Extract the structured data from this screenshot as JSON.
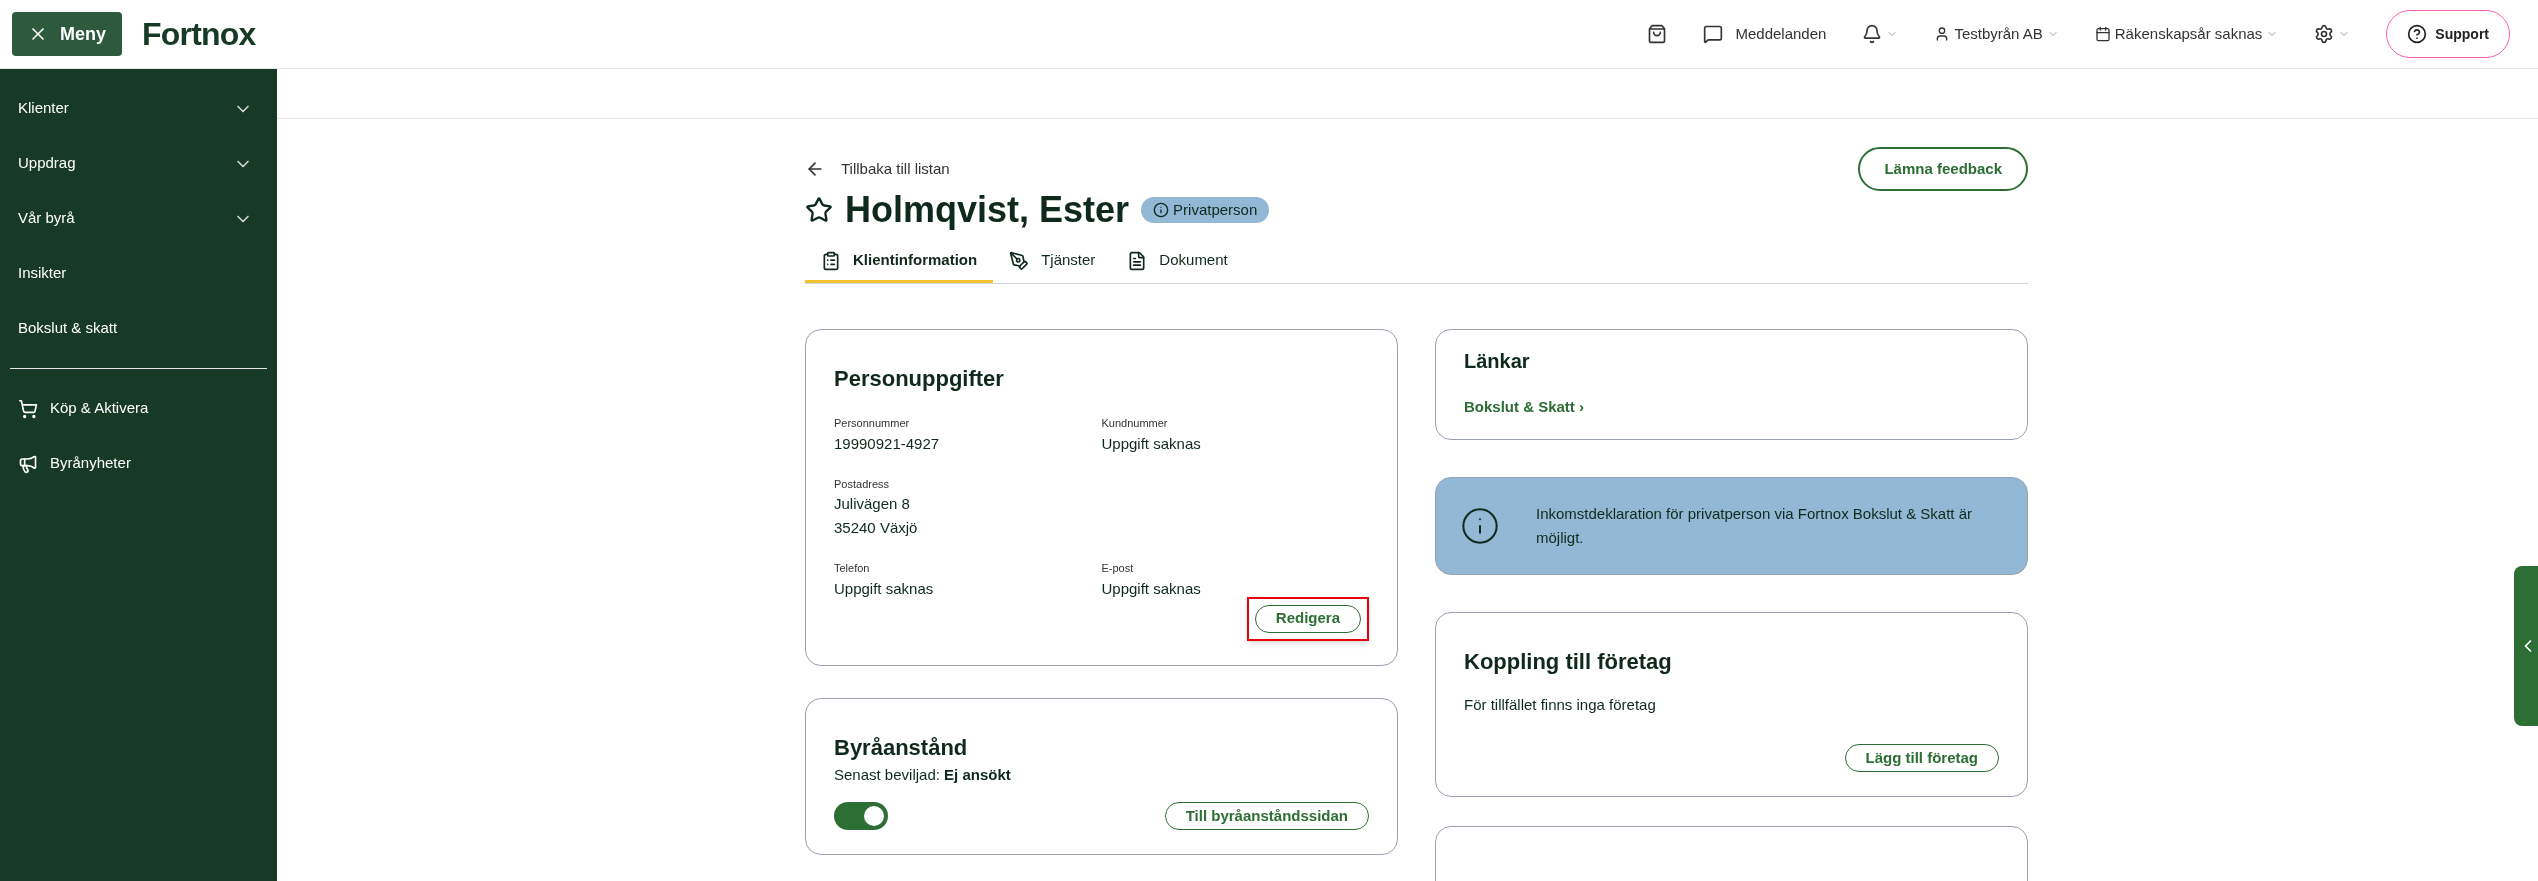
{
  "header": {
    "menu_button": "Meny",
    "logo": "Fortnox",
    "messages": "Meddelanden",
    "company": "Testbyrån AB",
    "fiscal_year": "Räkenskapsår saknas",
    "support": "Support"
  },
  "sidebar": {
    "groups": [
      {
        "label": "Klienter",
        "kind": "expandable",
        "expanded": false
      },
      {
        "label": "Uppdrag",
        "kind": "expandable",
        "expanded": false
      },
      {
        "label": "Vår byrå",
        "kind": "expandable",
        "expanded": false
      },
      {
        "label": "Insikter",
        "kind": "plain"
      },
      {
        "label": "Bokslut & skatt",
        "kind": "plain"
      }
    ],
    "shortcuts": [
      {
        "label": "Köp & Aktivera",
        "kind": "cart"
      },
      {
        "label": "Byrånyheter",
        "kind": "megaphone"
      }
    ]
  },
  "page": {
    "back": "Tillbaka till listan",
    "feedback": "Lämna feedback",
    "title": "Holmqvist, Ester",
    "badge": "Privatperson",
    "tabs": [
      {
        "label": "Klientinformation",
        "kind": "info",
        "selected": true
      },
      {
        "label": "Tjänster",
        "kind": "tools",
        "selected": false
      },
      {
        "label": "Dokument",
        "kind": "document",
        "selected": false
      }
    ]
  },
  "personal": {
    "title": "Personuppgifter",
    "rows": [
      [
        {
          "label": "Personnummer",
          "values": [
            "19990921-4927"
          ]
        },
        {
          "label": "Kundnummer",
          "values": [
            "Uppgift saknas"
          ]
        }
      ],
      [
        {
          "label": "Postadress",
          "values": [
            "Julivägen 8",
            "35240 Växjö"
          ]
        }
      ],
      [
        {
          "label": "Telefon",
          "values": [
            "Uppgift saknas"
          ]
        },
        {
          "label": "E-post",
          "values": [
            "Uppgift saknas"
          ]
        }
      ]
    ],
    "edit_button": {
      "label": "Redigera",
      "highlighted": true
    }
  },
  "deferral": {
    "title": "Byråanstånd",
    "status": "Senast beviljad: **Ej ansökt**",
    "toggle": {
      "on": true
    },
    "button": "Till byråanståndssidan"
  },
  "links": {
    "title": "Länkar",
    "items": [
      "Bokslut & Skatt ›"
    ]
  },
  "info": {
    "text": "Inkomstdeklaration för privatperson via Fortnox Bokslut & Skatt är möjligt."
  },
  "company_link": {
    "title": "Koppling till företag",
    "text": "För tillfället finns inga företag",
    "button": "Lägg till företag"
  }
}
